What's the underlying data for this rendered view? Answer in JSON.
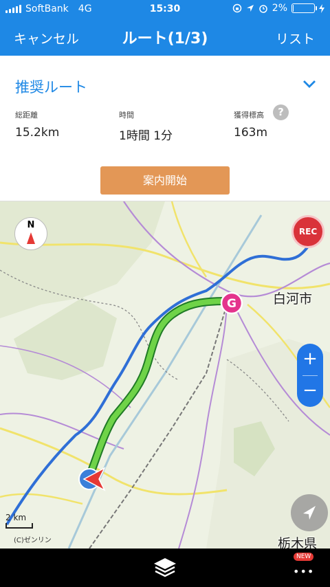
{
  "status_bar": {
    "carrier": "SoftBank",
    "network": "4G",
    "time": "15:30",
    "battery": "2%",
    "battery_level": 0.02
  },
  "nav": {
    "cancel_label": "キャンセル",
    "title": "ルート(1/3)",
    "list_label": "リスト"
  },
  "route": {
    "name": "推奨ルート",
    "stats": [
      {
        "label": "総距離",
        "value": "15.2km"
      },
      {
        "label": "時間",
        "value": "1時間 1分"
      },
      {
        "label": "獲得標高",
        "value": "163m"
      }
    ],
    "help_icon": "?",
    "start_label": "案内開始"
  },
  "map": {
    "compass_label": "N",
    "rec_label": "REC",
    "goal_label": "G",
    "city_label": "白河市",
    "ghost_label": "河市",
    "prefecture_label": "栃木県",
    "zoom_in": "+",
    "zoom_out": "−",
    "scale_label": "2 km",
    "copyright": "(C)ゼンリン"
  },
  "bottom": {
    "new_badge": "NEW",
    "more_label": "•••"
  },
  "colors": {
    "accent": "#1e88e5",
    "start_button": "#e39756",
    "route_green": "#6fd348",
    "route_blue": "#2f6fd6",
    "rec_red": "#d9333a",
    "goal_pink": "#e4348c"
  }
}
